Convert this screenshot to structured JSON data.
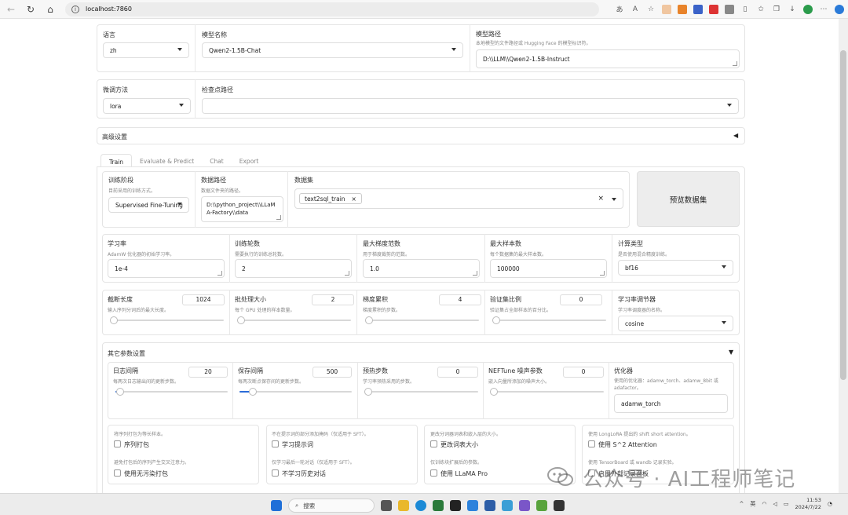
{
  "browser": {
    "url": "localhost:7860"
  },
  "top": {
    "lang_label": "语言",
    "lang_value": "zh",
    "model_name_label": "模型名称",
    "model_name_value": "Qwen2-1.5B-Chat",
    "model_path_label": "模型路径",
    "model_path_hint": "本地模型的文件路径或 Hugging Face 的模型标识符。",
    "model_path_value": "D:\\\\LLM\\\\Qwen2-1.5B-Instruct",
    "finetune_label": "微调方法",
    "finetune_value": "lora",
    "ckpt_label": "检查点路径",
    "advanced_label": "高级设置",
    "advanced_arrow": "◀"
  },
  "tabs": [
    "Train",
    "Evaluate & Predict",
    "Chat",
    "Export"
  ],
  "train": {
    "stage_label": "训练阶段",
    "stage_hint": "目前采用的训练方式。",
    "stage_value": "Supervised Fine-Tuning",
    "data_dir_label": "数据路径",
    "data_dir_hint": "数据文件夹的路径。",
    "data_dir_value": "D:\\\\python_project\\\\LLaMA-Factory\\\\data",
    "dataset_label": "数据集",
    "dataset_chip": "text2sql_train",
    "chip_x": "×",
    "clear_x": "×",
    "preview_button": "预览数据集",
    "lr_label": "学习率",
    "lr_hint": "AdamW 优化器的初始学习率。",
    "lr_value": "1e-4",
    "epochs_label": "训练轮数",
    "epochs_hint": "需要执行的训练总轮数。",
    "epochs_value": "2",
    "grad_norm_label": "最大梯度范数",
    "grad_norm_hint": "用于梯度裁剪的范数。",
    "grad_norm_value": "1.0",
    "max_samples_label": "最大样本数",
    "max_samples_hint": "每个数据集的最大样本数。",
    "max_samples_value": "100000",
    "compute_type_label": "计算类型",
    "compute_type_hint": "是否使用混合精度训练。",
    "compute_type_value": "bf16",
    "cutoff_label": "截断长度",
    "cutoff_hint": "输入序列分词后的最大长度。",
    "cutoff_value": "1024",
    "batch_label": "批处理大小",
    "batch_hint": "每个 GPU 处理的样本数量。",
    "batch_value": "2",
    "grad_acc_label": "梯度累积",
    "grad_acc_hint": "梯度累积的步数。",
    "grad_acc_value": "4",
    "val_label": "验证集比例",
    "val_hint": "验证集占全部样本的百分比。",
    "val_value": "0",
    "sched_label": "学习率调节器",
    "sched_hint": "学习率调度器的名称。",
    "sched_value": "cosine"
  },
  "other": {
    "title": "其它参数设置",
    "arrow": "▼",
    "log_label": "日志间隔",
    "log_hint": "每两次日志输出间的更新步数。",
    "log_value": "20",
    "save_label": "保存间隔",
    "save_hint": "每两次断点保存间的更新步数。",
    "save_value": "500",
    "warmup_label": "预热步数",
    "warmup_hint": "学习率预热采用的步数。",
    "warmup_value": "0",
    "neft_label": "NEFTune 噪声参数",
    "neft_hint": "嵌入向量所添加的噪声大小。",
    "neft_value": "0",
    "optim_label": "优化器",
    "optim_hint": "使用的优化器：adamw_torch、adamw_8bit 或 adafactor。",
    "optim_value": "adamw_torch",
    "c1_hint": "将序列打包为等长样本。",
    "c1_label": "序列打包",
    "c1b_hint": "避免打包后的序列产生交叉注意力。",
    "c1b_label": "使用无污染打包",
    "c2_hint": "不在提示词的部分添加掩码（仅适用于 SFT）。",
    "c2_label": "学习提示词",
    "c2b_hint": "仅学习最后一轮对话（仅适用于 SFT）。",
    "c2b_label": "不学习历史对话",
    "c3_hint": "更改分词器词表和嵌入层的大小。",
    "c3_label": "更改词表大小",
    "c3b_hint": "仅训练块扩展后的参数。",
    "c3b_label": "使用 LLaMA Pro",
    "c4_hint": "使用 LongLoRA 提出的 shift short attention。",
    "c4_label": "使用 S^2 Attention",
    "c4b_hint": "使用 TensorBoard 或 wandb 记录实验。",
    "c4b_label": "启用外部记录面板"
  },
  "taskbar": {
    "search": "搜索",
    "ime": "英",
    "time": "11:53",
    "date": "2024/7/22"
  },
  "watermark": "公众号 · AI工程师笔记"
}
